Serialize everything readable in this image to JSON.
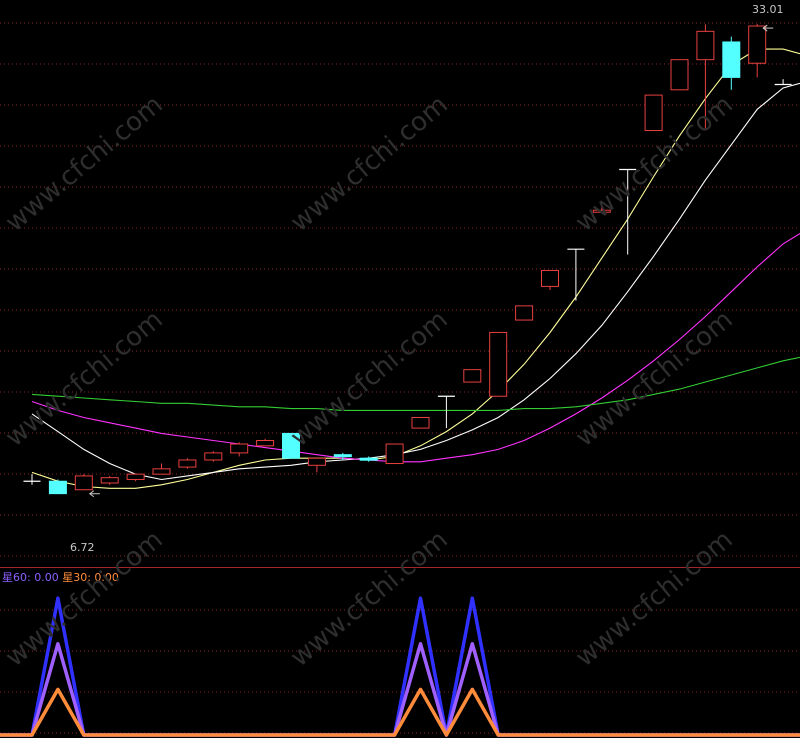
{
  "chart_data": [
    {
      "type": "candlestick",
      "title": "",
      "price_range": [
        3.6,
        34.2
      ],
      "grid": "dotted horizontal",
      "annotations": {
        "high_label": "33.01",
        "low_label": "6.72"
      },
      "candles": [
        {
          "o": 7.2,
          "h": 7.6,
          "l": 7.0,
          "c": 7.2,
          "dir": "flat"
        },
        {
          "o": 7.2,
          "h": 7.3,
          "l": 6.5,
          "c": 6.5,
          "dir": "down"
        },
        {
          "o": 6.72,
          "h": 7.6,
          "l": 6.72,
          "c": 7.5,
          "dir": "up"
        },
        {
          "o": 7.1,
          "h": 7.5,
          "l": 7.0,
          "c": 7.4,
          "dir": "up"
        },
        {
          "o": 7.3,
          "h": 7.6,
          "l": 7.2,
          "c": 7.6,
          "dir": "up"
        },
        {
          "o": 7.6,
          "h": 8.2,
          "l": 7.6,
          "c": 7.9,
          "dir": "up"
        },
        {
          "o": 8.0,
          "h": 8.5,
          "l": 7.9,
          "c": 8.4,
          "dir": "up"
        },
        {
          "o": 8.4,
          "h": 8.9,
          "l": 8.3,
          "c": 8.8,
          "dir": "up"
        },
        {
          "o": 8.8,
          "h": 9.4,
          "l": 8.6,
          "c": 9.3,
          "dir": "up"
        },
        {
          "o": 9.2,
          "h": 9.6,
          "l": 9.2,
          "c": 9.5,
          "dir": "up"
        },
        {
          "o": 9.9,
          "h": 9.9,
          "l": 8.5,
          "c": 8.5,
          "dir": "down"
        },
        {
          "o": 8.1,
          "h": 8.5,
          "l": 7.7,
          "c": 8.5,
          "dir": "up"
        },
        {
          "o": 8.7,
          "h": 8.8,
          "l": 8.4,
          "c": 8.6,
          "dir": "down"
        },
        {
          "o": 8.5,
          "h": 8.6,
          "l": 8.3,
          "c": 8.4,
          "dir": "down"
        },
        {
          "o": 8.2,
          "h": 9.3,
          "l": 8.2,
          "c": 9.3,
          "dir": "up"
        },
        {
          "o": 10.2,
          "h": 10.8,
          "l": 10.2,
          "c": 10.8,
          "dir": "up"
        },
        {
          "o": 12.0,
          "h": 12.0,
          "l": 10.2,
          "c": 12.0,
          "dir": "flat"
        },
        {
          "o": 12.8,
          "h": 13.5,
          "l": 12.8,
          "c": 13.5,
          "dir": "up"
        },
        {
          "o": 12.0,
          "h": 15.6,
          "l": 12.0,
          "c": 15.6,
          "dir": "up"
        },
        {
          "o": 16.3,
          "h": 17.1,
          "l": 16.3,
          "c": 17.1,
          "dir": "up"
        },
        {
          "o": 18.2,
          "h": 19.1,
          "l": 18.0,
          "c": 19.1,
          "dir": "up"
        },
        {
          "o": 20.3,
          "h": 20.3,
          "l": 17.4,
          "c": 20.3,
          "dir": "flat"
        },
        {
          "o": 22.5,
          "h": 22.8,
          "l": 22.4,
          "c": 22.5,
          "dir": "up"
        },
        {
          "o": 24.8,
          "h": 24.8,
          "l": 20.0,
          "c": 24.8,
          "dir": "flat"
        },
        {
          "o": 27.0,
          "h": 29.0,
          "l": 27.0,
          "c": 29.0,
          "dir": "up"
        },
        {
          "o": 29.3,
          "h": 31.0,
          "l": 29.3,
          "c": 31.0,
          "dir": "up"
        },
        {
          "o": 31.0,
          "h": 33.0,
          "l": 27.0,
          "c": 32.6,
          "dir": "up"
        },
        {
          "o": 32.0,
          "h": 32.3,
          "l": 29.3,
          "c": 30.0,
          "dir": "down"
        },
        {
          "o": 30.8,
          "h": 33.01,
          "l": 30.0,
          "c": 32.9,
          "dir": "up"
        },
        {
          "o": 29.6,
          "h": 29.9,
          "l": 29.6,
          "c": 29.6,
          "dir": "flat"
        },
        {
          "o": 27.5,
          "h": 30.0,
          "l": 27.5,
          "c": 29.6,
          "dir": "up"
        }
      ],
      "moving_averages": [
        {
          "color": "#ffff99",
          "values": [
            7.7,
            7.2,
            6.9,
            6.8,
            6.8,
            7.0,
            7.3,
            7.7,
            8.1,
            8.4,
            8.5,
            8.5,
            8.5,
            8.4,
            8.6,
            9.2,
            10.0,
            11.0,
            12.3,
            13.8,
            15.6,
            17.6,
            19.8,
            22.0,
            24.4,
            26.7,
            28.8,
            30.7,
            31.6,
            31.6,
            31.2
          ]
        },
        {
          "color": "#ffffff",
          "values": [
            11.0,
            10.0,
            9.0,
            8.2,
            7.6,
            7.3,
            7.5,
            7.7,
            7.9,
            8.0,
            8.1,
            8.3,
            8.4,
            8.5,
            8.7,
            9.0,
            9.5,
            10.1,
            10.8,
            11.8,
            13.0,
            14.4,
            16.0,
            17.9,
            19.9,
            22.0,
            24.2,
            26.2,
            28.2,
            29.4,
            29.8
          ]
        },
        {
          "color": "#ff33ff",
          "values": [
            11.7,
            11.2,
            10.8,
            10.5,
            10.2,
            9.9,
            9.7,
            9.5,
            9.3,
            9.1,
            8.9,
            8.7,
            8.5,
            8.4,
            8.3,
            8.3,
            8.5,
            8.7,
            9.0,
            9.5,
            10.2,
            11.0,
            11.9,
            12.9,
            14.0,
            15.2,
            16.5,
            17.9,
            19.3,
            20.6,
            21.5
          ]
        },
        {
          "color": "#33cc33",
          "values": [
            12.1,
            12.0,
            11.9,
            11.8,
            11.7,
            11.6,
            11.6,
            11.5,
            11.4,
            11.4,
            11.3,
            11.3,
            11.2,
            11.2,
            11.2,
            11.2,
            11.2,
            11.2,
            11.2,
            11.3,
            11.3,
            11.4,
            11.6,
            11.8,
            12.1,
            12.4,
            12.8,
            13.2,
            13.6,
            14.0,
            14.3
          ]
        }
      ]
    },
    {
      "type": "line",
      "title": "",
      "ylim": [
        0,
        1
      ],
      "legend": [
        {
          "label": "星60: 0.00",
          "color": "#8a60ff"
        },
        {
          "label": "星30: 0.00",
          "color": "#ff8c3a"
        }
      ],
      "series": [
        {
          "color": "#3030ff",
          "values": [
            0,
            0.9,
            0,
            0,
            0,
            0,
            0,
            0,
            0,
            0,
            0,
            0,
            0,
            0,
            0,
            0.9,
            0,
            0.9,
            0,
            0,
            0,
            0,
            0,
            0,
            0,
            0,
            0,
            0,
            0,
            0,
            0
          ]
        },
        {
          "color": "#a060ff",
          "values": [
            0,
            0.6,
            0,
            0,
            0,
            0,
            0,
            0,
            0,
            0,
            0,
            0,
            0,
            0,
            0,
            0.6,
            0,
            0.6,
            0,
            0,
            0,
            0,
            0,
            0,
            0,
            0,
            0,
            0,
            0,
            0,
            0
          ]
        },
        {
          "color": "#ff8c3a",
          "values": [
            0,
            0.3,
            0,
            0,
            0,
            0,
            0,
            0,
            0,
            0,
            0,
            0,
            0,
            0,
            0,
            0.3,
            0,
            0.3,
            0,
            0,
            0,
            0,
            0,
            0,
            0,
            0,
            0,
            0,
            0,
            0,
            0
          ]
        }
      ]
    }
  ],
  "watermark": "www.cfchi.com"
}
